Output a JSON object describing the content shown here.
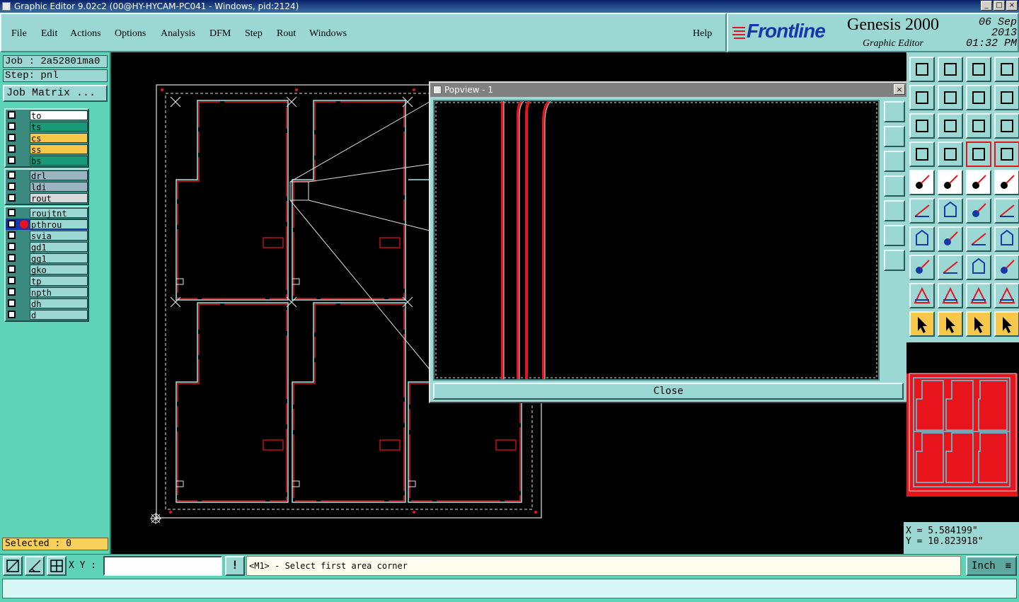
{
  "window": {
    "title": "Graphic Editor 9.02c2 (00@HY-HYCAM-PC041 - Windows, pid:2124)",
    "controls": [
      "_",
      "□",
      "×"
    ]
  },
  "menu": {
    "items": [
      "File",
      "Edit",
      "Actions",
      "Options",
      "Analysis",
      "DFM",
      "Step",
      "Rout",
      "Windows"
    ],
    "help": "Help"
  },
  "brand": {
    "logo": "Frontline",
    "product": "Genesis 2000",
    "subtitle": "Graphic Editor",
    "date": "06 Sep 2013",
    "time": "01:32 PM"
  },
  "job": {
    "job_label": "Job : 2a52801ma0",
    "step_label": "Step: pnl",
    "matrix_button": "Job Matrix ..."
  },
  "layers": {
    "group1": [
      {
        "name": "to",
        "color": "#ffffff"
      },
      {
        "name": "ts",
        "color": "#1a9a78"
      },
      {
        "name": "cs",
        "color": "#f8c84a"
      },
      {
        "name": "ss",
        "color": "#f8c84a"
      },
      {
        "name": "bs",
        "color": "#1a9a78"
      }
    ],
    "group2": [
      {
        "name": "drl",
        "color": "#9ab4c0"
      },
      {
        "name": "ldi",
        "color": "#9ab4c0"
      },
      {
        "name": "rout",
        "color": "#d8d8d8"
      }
    ],
    "group3": [
      {
        "name": "roujtnt",
        "color": "#9bd8d4"
      },
      {
        "name": "pthrou",
        "color": "#9bd8d4",
        "active": true
      },
      {
        "name": "svia",
        "color": "#9bd8d4"
      },
      {
        "name": "gd1",
        "color": "#9bd8d4"
      },
      {
        "name": "gg1",
        "color": "#9bd8d4"
      },
      {
        "name": "gko",
        "color": "#9bd8d4"
      },
      {
        "name": "tp",
        "color": "#9bd8d4"
      },
      {
        "name": "npth",
        "color": "#9bd8d4"
      },
      {
        "name": "dh",
        "color": "#9bd8d4"
      },
      {
        "name": "d",
        "color": "#9bd8d4"
      }
    ]
  },
  "selected": "Selected : 0",
  "popview": {
    "title": "Popview - 1",
    "close_label": "Close"
  },
  "coords": {
    "x": "X = 5.584199\"",
    "y": "Y = 10.823918\""
  },
  "command": {
    "xy_label": "X Y :",
    "xy_value": "",
    "warn": "!",
    "message": "<M1> - Select first area corner",
    "units": "Inch"
  },
  "colors": {
    "panel": "#9bd8d4",
    "teal": "#5fd3b8",
    "trace_red": "#e8141c",
    "outline_cyan": "#9fe8e8"
  }
}
